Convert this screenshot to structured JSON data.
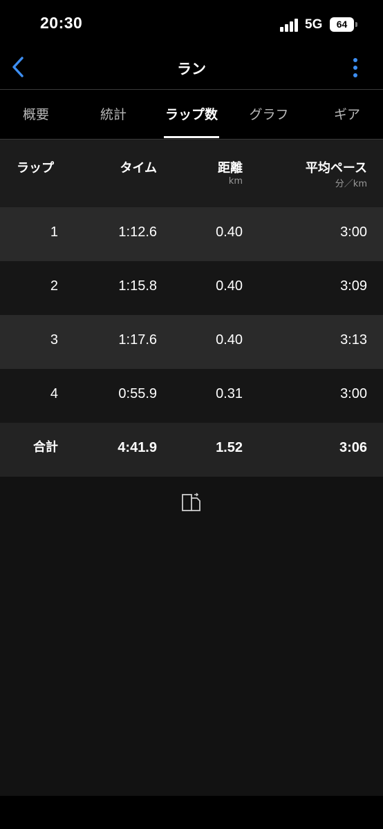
{
  "status_bar": {
    "time": "20:30",
    "network": "5G",
    "battery": "64"
  },
  "header": {
    "title": "ラン",
    "back_icon": "chevron-left-icon",
    "more_icon": "vertical-dots-icon"
  },
  "tabs": [
    {
      "label": "概要",
      "active": false
    },
    {
      "label": "統計",
      "active": false
    },
    {
      "label": "ラップ数",
      "active": true
    },
    {
      "label": "グラフ",
      "active": false
    },
    {
      "label": "ギア",
      "active": false
    }
  ],
  "table": {
    "columns": [
      {
        "label": "ラップ",
        "unit": ""
      },
      {
        "label": "タイム",
        "unit": ""
      },
      {
        "label": "距離",
        "unit": "km"
      },
      {
        "label": "平均ペース",
        "unit": "分／km"
      }
    ],
    "rows": [
      {
        "lap": "1",
        "time": "1:12.6",
        "distance": "0.40",
        "pace": "3:00"
      },
      {
        "lap": "2",
        "time": "1:15.8",
        "distance": "0.40",
        "pace": "3:09"
      },
      {
        "lap": "3",
        "time": "1:17.6",
        "distance": "0.40",
        "pace": "3:13"
      },
      {
        "lap": "4",
        "time": "0:55.9",
        "distance": "0.31",
        "pace": "3:00"
      }
    ],
    "total": {
      "lap": "合計",
      "time": "4:41.9",
      "distance": "1.52",
      "pace": "3:06"
    }
  },
  "export_icon": "export-document-icon",
  "colors": {
    "accent": "#3d8ef2",
    "background": "#121212"
  }
}
